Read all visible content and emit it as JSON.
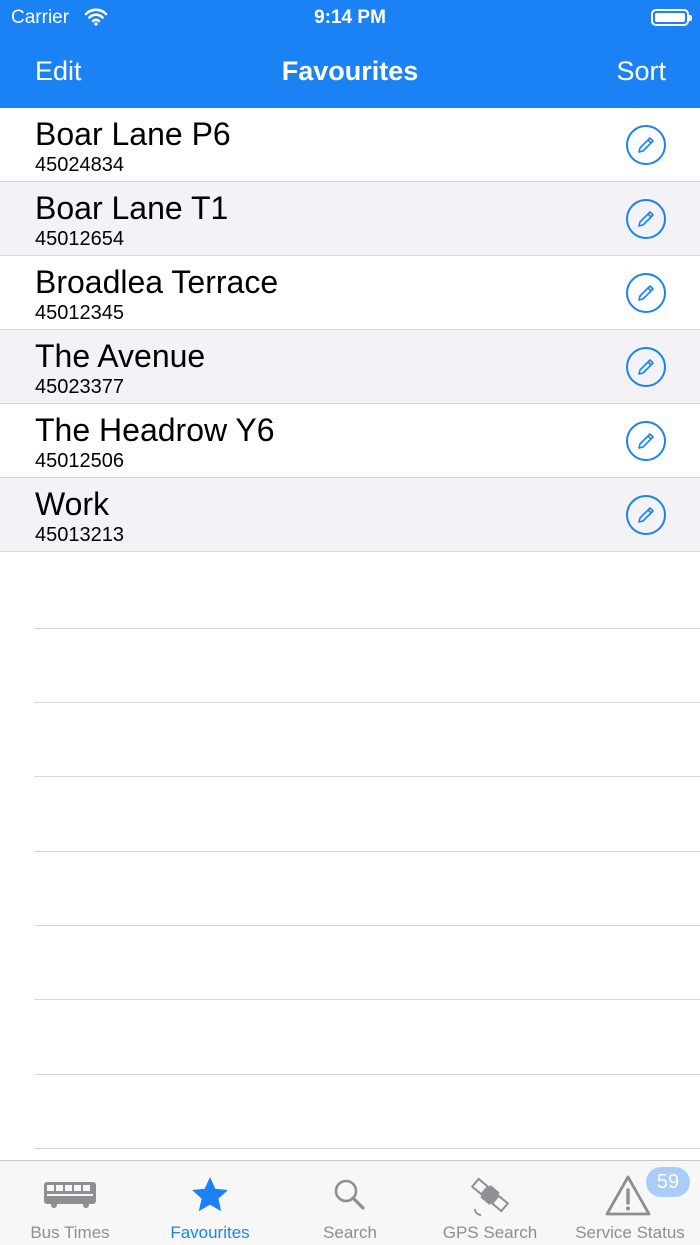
{
  "status_bar": {
    "carrier": "Carrier",
    "time": "9:14 PM"
  },
  "nav": {
    "edit_label": "Edit",
    "title": "Favourites",
    "sort_label": "Sort"
  },
  "favourites": [
    {
      "name": "Boar Lane P6",
      "code": "45024834"
    },
    {
      "name": "Boar Lane T1",
      "code": "45012654"
    },
    {
      "name": "Broadlea Terrace",
      "code": "45012345"
    },
    {
      "name": "The Avenue",
      "code": "45023377"
    },
    {
      "name": "The Headrow Y6",
      "code": "45012506"
    },
    {
      "name": "Work",
      "code": "45013213"
    }
  ],
  "tabs": [
    {
      "label": "Bus Times",
      "icon": "bus-icon"
    },
    {
      "label": "Favourites",
      "icon": "star-icon"
    },
    {
      "label": "Search",
      "icon": "magnifier-icon"
    },
    {
      "label": "GPS Search",
      "icon": "satellite-icon"
    },
    {
      "label": "Service Status",
      "icon": "warning-icon"
    }
  ],
  "service_status_badge": "59",
  "colors": {
    "accent": "#1a82f4",
    "inactive": "#8e8e93",
    "alt_row": "#f2f2f7",
    "badge": "#a9cdf7"
  }
}
